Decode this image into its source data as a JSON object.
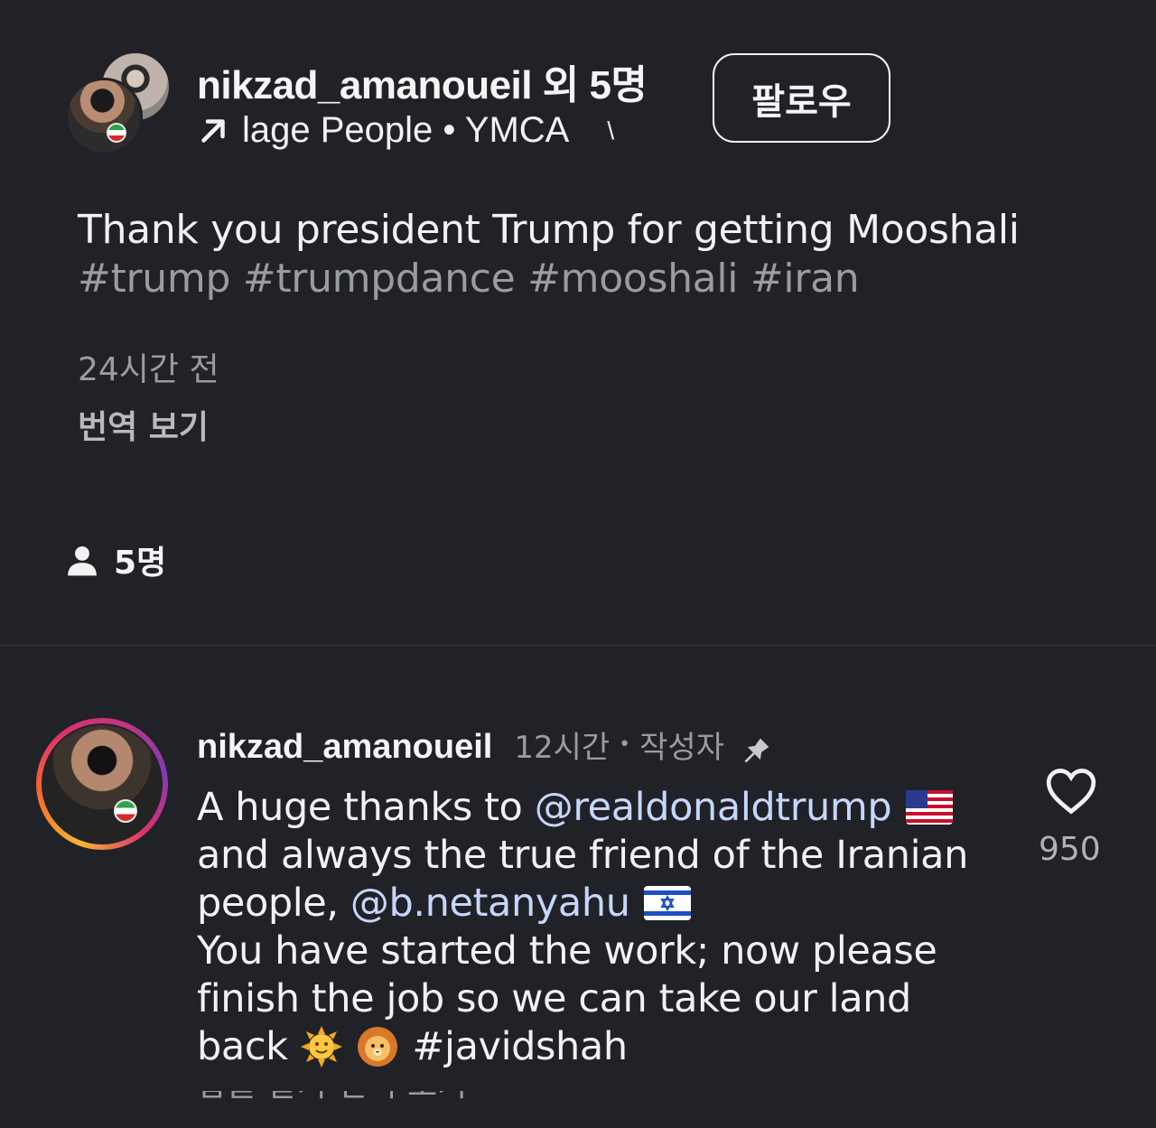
{
  "post": {
    "username": "nikzad_amanoueil",
    "coauthors_suffix": "외 5명",
    "music": "lage People • YMCA",
    "music_trailing": "\\",
    "follow_label": "팔로우",
    "caption_text": "Thank you president Trump for getting Mooshali",
    "caption_hashtags": "#trump #trumpdance #mooshali #iran",
    "timestamp": "24시간 전",
    "translate_label": "번역 보기",
    "tagged_people_count": "5명"
  },
  "comment": {
    "username": "nikzad_amanoueil",
    "time": "12시간",
    "separator": "•",
    "author_label": "작성자",
    "text_1": "A huge thanks to ",
    "mention_1": "@realdonaldtrump",
    "text_2": "and always the true friend of the Iranian people, ",
    "mention_2": "@b.netanyahu",
    "text_3": "You have started the work; now please finish the job so we can take our land back ",
    "hashtag": "#javidshah",
    "like_count": "950",
    "cut_off_row": "답글 달기    번역 보기"
  },
  "icons": {
    "arrow": "arrow-up-right-icon",
    "people": "person-icon",
    "pin": "pin-icon",
    "heart": "heart-icon",
    "flag_us": "us-flag-icon",
    "flag_il": "israel-flag-icon",
    "sun": "sun-emoji-icon",
    "lion": "lion-emoji-icon"
  },
  "colors": {
    "background": "#202227",
    "text": "#f2f2f2",
    "muted": "#9a9ca2",
    "mention": "#c6d7ff"
  }
}
